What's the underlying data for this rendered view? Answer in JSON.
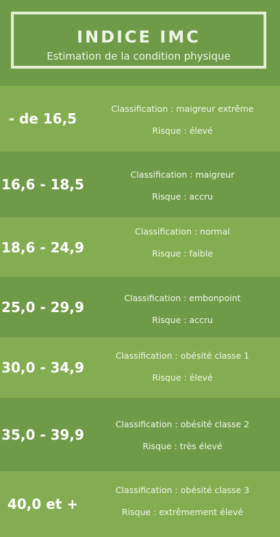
{
  "header": {
    "title": "INDICE IMC",
    "subtitle": "Estimation de la condition physique"
  },
  "colors": {
    "dark_green": "#6f9a48",
    "light_green": "#84ad51",
    "frame": "#e4f1d6",
    "text": "#ffffff"
  },
  "rows": [
    {
      "range": "- de 16,5",
      "classification": "Classification : maigreur extrême",
      "risk": "Risque : élevé"
    },
    {
      "range": "16,6 - 18,5",
      "classification": "Classification : maigreur",
      "risk": "Risque : accru"
    },
    {
      "range": "18,6 - 24,9",
      "classification": "Classification : normal",
      "risk": "Risque : faible"
    },
    {
      "range": "25,0 - 29,9",
      "classification": "Classification : embonpoint",
      "risk": "Risque : accru"
    },
    {
      "range": "30,0 - 34,9",
      "classification": "Classification : obésité classe 1",
      "risk": "Risque : élevé"
    },
    {
      "range": "35,0 - 39,9",
      "classification": "Classification : obésité classe 2",
      "risk": "Risque : très élevé"
    },
    {
      "range": "40,0 et +",
      "classification": "Classification : obésité classe 3",
      "risk": "Risque : extrêmement élevé"
    }
  ]
}
